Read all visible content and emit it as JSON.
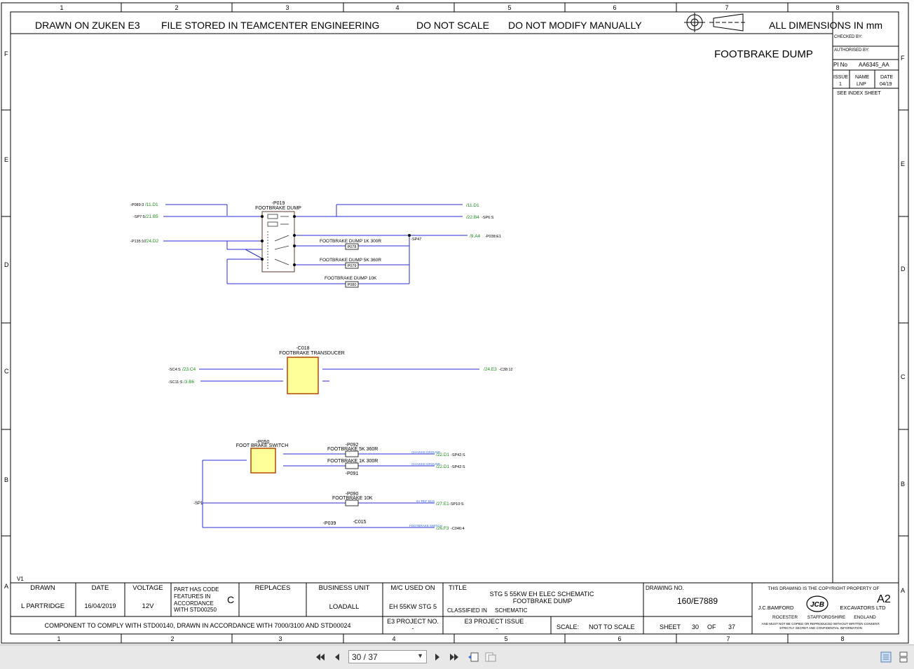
{
  "border": {
    "columns": [
      "1",
      "2",
      "3",
      "4",
      "5",
      "6",
      "7",
      "8"
    ],
    "rows_left": [
      "F",
      "E",
      "D",
      "C",
      "B",
      "A"
    ],
    "rows_right": [
      "F",
      "E",
      "D",
      "C",
      "B",
      "A"
    ]
  },
  "header": {
    "drawn_on": "DRAWN ON ZUKEN E3",
    "file_stored": "FILE STORED IN TEAMCENTER ENGINEERING",
    "do_not_scale": "DO NOT SCALE",
    "do_not_modify": "DO NOT MODIFY MANUALLY",
    "dimensions": "ALL DIMENSIONS IN mm"
  },
  "sheet_title": "FOOTBRAKE DUMP",
  "side_box": {
    "checked_by": "CHECKED BY:",
    "authorised_by": "AUTHORISED BY:",
    "pi_no_label": "PI No",
    "pi_no": "AA6345_AA",
    "issue_label": "ISSUE",
    "name_label": "NAME",
    "date_label": "DATE",
    "issue": "1",
    "name": "LNP",
    "date": "04/19",
    "see_index": "SEE INDEX SHEET"
  },
  "schematic": {
    "p019": {
      "ref": "-P019",
      "name": "FOOTBRAKE DUMP"
    },
    "p019_in": [
      {
        "src": "-P089:3",
        "ref": "/11.D1"
      },
      {
        "src": "-SP7:5",
        "ref": "/21.B5"
      },
      {
        "src": "-P135:10",
        "ref": "/24.D2"
      }
    ],
    "p019_out": [
      {
        "ref": "/11.D1",
        "dst": ""
      },
      {
        "ref": "/22.B4",
        "dst": "-SP6:S"
      },
      {
        "ref": "/9.A4",
        "dst": "-P038:E1"
      }
    ],
    "sp47": "-SP47",
    "p078": {
      "ref": "P078",
      "label": "FOOTBRAKE DUMP 1K 300R"
    },
    "p079": {
      "ref": "P079",
      "label": "FOOTBRAKE DUMP 5K 360R"
    },
    "p080": {
      "ref": "P080",
      "label": "FOOTBRAKE DUMP 10K"
    },
    "c018": {
      "ref": "-C018",
      "name": "FOOTBRAKE TRANSDUCER"
    },
    "c018_in": [
      {
        "src": "-SC4:S",
        "ref": "/23.C4"
      },
      {
        "src": "-SC11:S",
        "ref": "/3.B6"
      }
    ],
    "c018_out": {
      "ref": "/24.E3",
      "dst": "-C38:12"
    },
    "p050": {
      "ref": "-P050",
      "name": "FOOT BRAKE SWITCH"
    },
    "p092": {
      "ref": "-P092",
      "label": "FOOTBRAKE 5K 360R"
    },
    "p091": {
      "ref": "-P091",
      "label": "FOOTBRAKE 1K 300R"
    },
    "p090": {
      "ref": "-P090",
      "label": "FOOTBRAKE 10K"
    },
    "p039": "-P039",
    "c015": "-C015",
    "sp1": "-SP1",
    "switch_out": [
      {
        "note": "CHASSIS GROUND",
        "ref": "/22.D1",
        "dst": "-SP42:S"
      },
      {
        "note": "CHASSIS GROUND",
        "ref": "/22.D1",
        "dst": "-SP42:S"
      },
      {
        "note": "5V REF BUS",
        "ref": "/27.E1",
        "dst": "-SP10:S"
      },
      {
        "note": "FOOTBRAKE SWITCH",
        "ref": "/26.F3",
        "dst": "-C046:4"
      }
    ]
  },
  "title_block": {
    "v1": "V1",
    "drawn_label": "DRAWN",
    "drawn": "L PARTRIDGE",
    "date_label": "DATE",
    "date": "16/04/2019",
    "voltage_label": "VOLTAGE",
    "voltage": "12V",
    "part_code_lines": [
      "PART HAS CODE",
      "FEATURES IN",
      "ACCORDANCE",
      "WITH STD00250"
    ],
    "part_code_letter": "C",
    "replaces_label": "REPLACES",
    "business_unit_label": "BUSINESS UNIT",
    "business_unit": "LOADALL",
    "mc_used_on_label": "M/C USED ON",
    "mc_used_on": "EH 55KW STG 5",
    "title_label": "TITLE",
    "title_line1": "STG 5 55KW EH ELEC SCHEMATIC",
    "title_line2": "FOOTBRAKE DUMP",
    "classified_label": "CLASSIFIED IN",
    "classified": "SCHEMATIC",
    "drawing_no_label": "DRAWING NO.",
    "drawing_no": "160/E7889",
    "copyright": "THIS DRAWING IS THE COPYRIGHT PROPERTY OF",
    "sheet_size": "A2",
    "company_left": "J.C.BAMFORD",
    "company_right": "EXCAVATORS LTD",
    "addr1": "ROCESTER",
    "addr2": "STAFFORDSHIRE",
    "addr3": "ENGLAND",
    "notice1": "AND MUST NOT BE COPIED OR REPRODUCED WITHOUT WRITTEN CONSENT.",
    "notice2": "STRICTLY SECRET AND CONFIDENTIAL INFORMATION",
    "component": "COMPONENT TO COMPLY WITH STD00140, DRAWN IN ACCORDANCE WITH 7000/3100 AND STD00024",
    "e3_project_no_label": "E3 PROJECT NO.",
    "e3_project_no": "-",
    "e3_project_issue_label": "E3 PROJECT ISSUE",
    "e3_project_issue": "-",
    "scale_label": "SCALE:",
    "scale": "NOT TO SCALE",
    "sheet_label": "SHEET",
    "sheet": "30",
    "of_label": "OF",
    "of": "37"
  },
  "viewer": {
    "page_indicator": "30 / 37"
  },
  "colors": {
    "wire": "#2b2bd6",
    "ref_green": "#1a8a1a",
    "component_fill": "#ffff99",
    "component_border": "#b34a00",
    "note_blue": "#3a6fd8"
  }
}
